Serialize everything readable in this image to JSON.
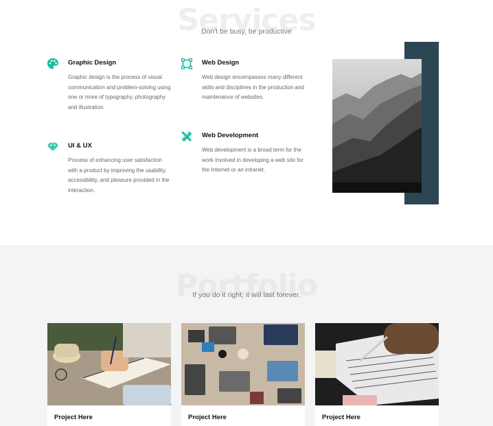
{
  "services": {
    "title": "Services",
    "subtitle": "Don't be busy, be productive",
    "items": [
      {
        "icon": "palette-icon",
        "title": "Graphic Design",
        "text": "Graphic design is the process of visual communication and problem-solving using one or more of typography, photography and illustration."
      },
      {
        "icon": "vector-square-icon",
        "title": "Web Design",
        "text": "Web design encompasses many different skills and disciplines in the production and maintenance of websites."
      },
      {
        "icon": "diamond-icon",
        "title": "UI & UX",
        "text": "Process of enhancing user satisfaction with a product by improving the usability, accessibility, and pleasure provided in the interaction."
      },
      {
        "icon": "tools-icon",
        "title": "Web Development",
        "text": "Web development is a broad term for the work involved in developing a web site for the Internet or an intranet."
      }
    ]
  },
  "portfolio": {
    "title": "Portfolio",
    "subtitle": "If you do it right, it will last forever.",
    "cards": [
      {
        "title": "Project Here"
      },
      {
        "title": "Project Here"
      },
      {
        "title": "Project Here"
      }
    ]
  },
  "colors": {
    "accent": "#1abc9c",
    "dark_block": "#2d4654",
    "section_bg": "#f4f4f4"
  }
}
